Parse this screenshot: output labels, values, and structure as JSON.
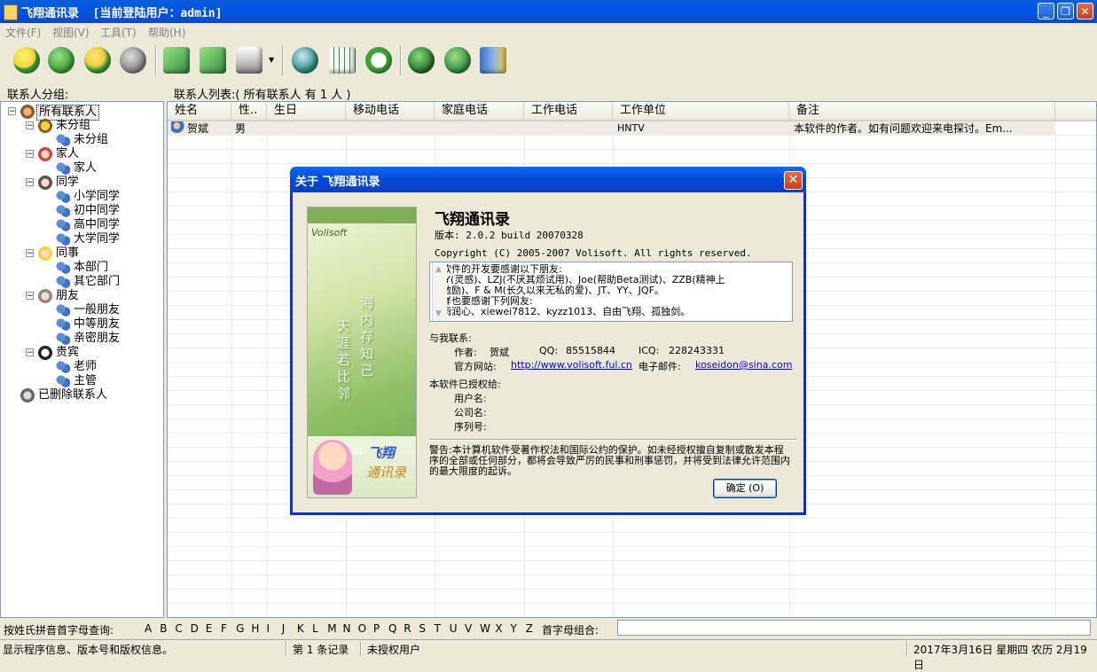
{
  "window": {
    "title": "飞翔通讯录  [当前登陆用户：admin]"
  },
  "menu": [
    "文件(F)",
    "视图(V)",
    "工具(T)",
    "帮助(H)"
  ],
  "toolbar": {
    "icons": [
      "smiley-add-icon",
      "refresh-contact-icon",
      "delete-contact-icon",
      "edit-contact-icon",
      "import-icon",
      "export-icon",
      "print-icon",
      "search-icon",
      "calendar-icon",
      "timer-icon",
      "help-icon",
      "info-icon",
      "exit-icon"
    ],
    "colors": {
      "green": "#3fa33a",
      "yellow": "#f4d23c",
      "red": "#d8362e",
      "grey": "#8a8a8a",
      "teal": "#2f8f7f",
      "blue": "#3c72c8"
    }
  },
  "tree": {
    "heading": "联系人分组:",
    "root": "所有联系人",
    "groups": [
      {
        "name": "未分组",
        "children": [
          "未分组"
        ]
      },
      {
        "name": "家人",
        "children": [
          "家人"
        ]
      },
      {
        "name": "同学",
        "children": [
          "小学同学",
          "初中同学",
          "高中同学",
          "大学同学"
        ]
      },
      {
        "name": "同事",
        "children": [
          "本部门",
          "其它部门"
        ]
      },
      {
        "name": "朋友",
        "children": [
          "一般朋友",
          "中等朋友",
          "亲密朋友"
        ]
      },
      {
        "name": "贵宾",
        "children": [
          "老师",
          "主管"
        ]
      }
    ],
    "deleted": "已删除联系人"
  },
  "list": {
    "heading": "联系人列表:( 所有联系人 有 1 人 )",
    "columns": [
      "姓名",
      "性..",
      "生日",
      "移动电话",
      "家庭电话",
      "工作电话",
      "工作单位",
      "备注"
    ],
    "rows": [
      {
        "name": "贺斌",
        "gender": "男",
        "birthday": "",
        "mobile": "",
        "home": "",
        "work_phone": "",
        "company": "HNTV",
        "note": "本软件的作者。如有问题欢迎来电探讨。Em..."
      }
    ]
  },
  "letters": {
    "label": "按姓氏拼音首字母查询:",
    "items": [
      "A",
      "B",
      "C",
      "D",
      "E",
      "F",
      "G",
      "H",
      "I",
      "J",
      "K",
      "L",
      "M",
      "N",
      "O",
      "P",
      "Q",
      "R",
      "S",
      "T",
      "U",
      "V",
      "W",
      "X",
      "Y",
      "Z"
    ],
    "combo_label": "首字母组合:",
    "combo_value": ""
  },
  "status": {
    "hint": "显示程序信息、版本号和版权信息。",
    "record": "第 1 条记录",
    "license": "未授权用户",
    "date": "2017年3月16日 星期四 农历 2月19日"
  },
  "about": {
    "title": "关于 飞翔通讯录",
    "app_name": "飞翔通讯录",
    "version": "版本: 2.0.2 build 20070328",
    "copyright": "Copyright (C) 2005-2007 Volisoft. All rights reserved.",
    "banner_brand": "Volisoft",
    "banner_poem": [
      "海内存知己",
      "天涯若比邻"
    ],
    "banner_logo1": "飞翔",
    "banner_logo2": "通讯录",
    "thanks": [
      "本软件的开发要感谢以下朋友:",
      "    ZYY(灵感)、LZJ(不厌其烦试用)、Joe(帮助Beta测试)、ZZB(精神上",
      "的激励)、F & M(长久以来无私的爱)、JT、YY、JQF。",
      "同样也要感谢下列网友:",
      "    甜雨润心、xiewei7812、kyzz1013、自由飞翔、孤独剑。"
    ],
    "contact_heading": "与我联系:",
    "author_label": "作者:",
    "author": "贺斌",
    "qq_label": "QQ:",
    "qq": "85515844",
    "icq_label": "ICQ:",
    "icq": "228243331",
    "site_label": "官方网站:",
    "site": "http://www.volisoft.ful.cn",
    "email_label": "电子邮件:",
    "email": "koseidon@sina.com",
    "licensed_heading": "本软件已授权给:",
    "user_label": "用户名:",
    "company_label": "公司名:",
    "serial_label": "序列号:",
    "warning": "警告:本计算机软件受著作权法和国际公约的保护。如未经授权擅自复制或散发本程序的全部或任何部分，都将会导致严厉的民事和刑事惩罚，并将受到法律允许范围内的最大限度的起诉。",
    "ok": "确定 (O)"
  }
}
